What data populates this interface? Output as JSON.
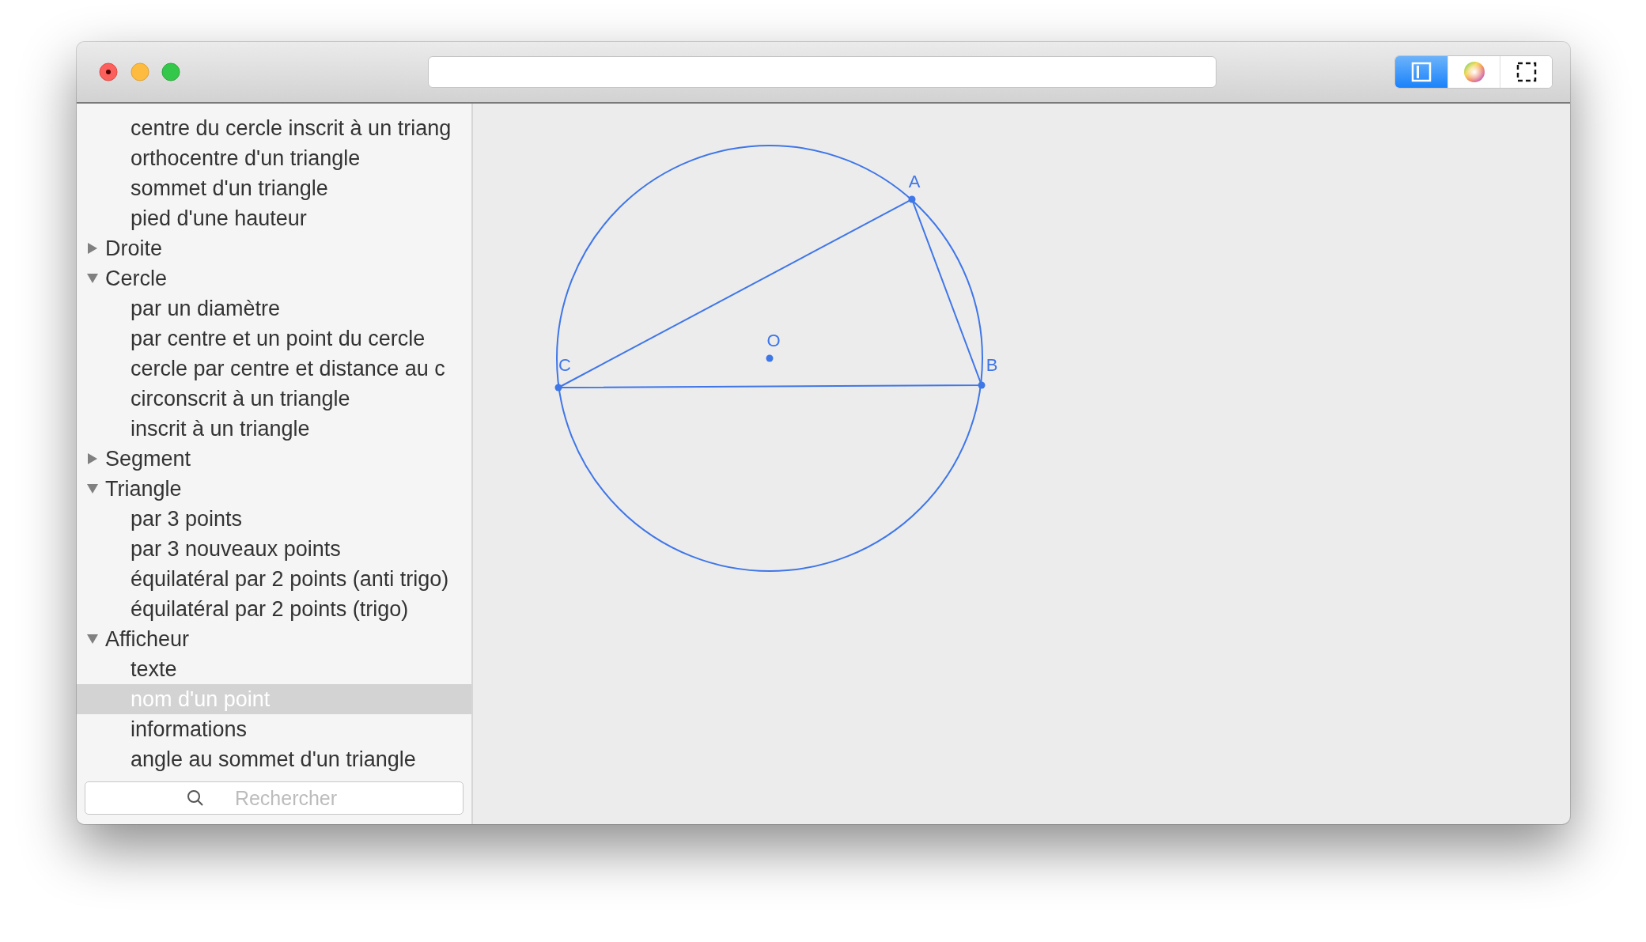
{
  "toolbar": {
    "view_buttons": [
      {
        "kind": "sidebar",
        "selected": true
      },
      {
        "kind": "colors",
        "selected": false
      },
      {
        "kind": "fullscreen",
        "selected": false
      }
    ]
  },
  "sidebar": {
    "tree": [
      {
        "children": [
          {
            "label": "centre du cercle inscrit à un triang",
            "selected": false
          },
          {
            "label": "orthocentre d'un triangle",
            "selected": false
          },
          {
            "label": "sommet d'un triangle",
            "selected": false
          },
          {
            "label": "pied d'une hauteur",
            "selected": false
          }
        ]
      },
      {
        "label": "Droite",
        "expanded": false
      },
      {
        "label": "Cercle",
        "expanded": true,
        "children": [
          {
            "label": "par un diamètre",
            "selected": false
          },
          {
            "label": "par centre et un point du cercle",
            "selected": false
          },
          {
            "label": "cercle par centre et distance au c",
            "selected": false
          },
          {
            "label": "circonscrit à un triangle",
            "selected": false
          },
          {
            "label": "inscrit à un triangle",
            "selected": false
          }
        ]
      },
      {
        "label": "Segment",
        "expanded": false
      },
      {
        "label": "Triangle",
        "expanded": true,
        "children": [
          {
            "label": "par 3 points",
            "selected": false
          },
          {
            "label": "par 3 nouveaux points",
            "selected": false
          },
          {
            "label": "équilatéral par 2 points (anti trigo)",
            "selected": false
          },
          {
            "label": "équilatéral par 2 points (trigo)",
            "selected": false
          }
        ]
      },
      {
        "label": "Afficheur",
        "expanded": true,
        "children": [
          {
            "label": "texte",
            "selected": false
          },
          {
            "label": "nom d'un point",
            "selected": true
          },
          {
            "label": "informations",
            "selected": false
          },
          {
            "label": "angle au sommet d'un triangle",
            "selected": false
          }
        ]
      }
    ],
    "search": {
      "placeholder": "Rechercher"
    }
  },
  "figure": {
    "points": [
      {
        "label": "A"
      },
      {
        "label": "B"
      },
      {
        "label": "C"
      },
      {
        "label": "O"
      }
    ]
  }
}
